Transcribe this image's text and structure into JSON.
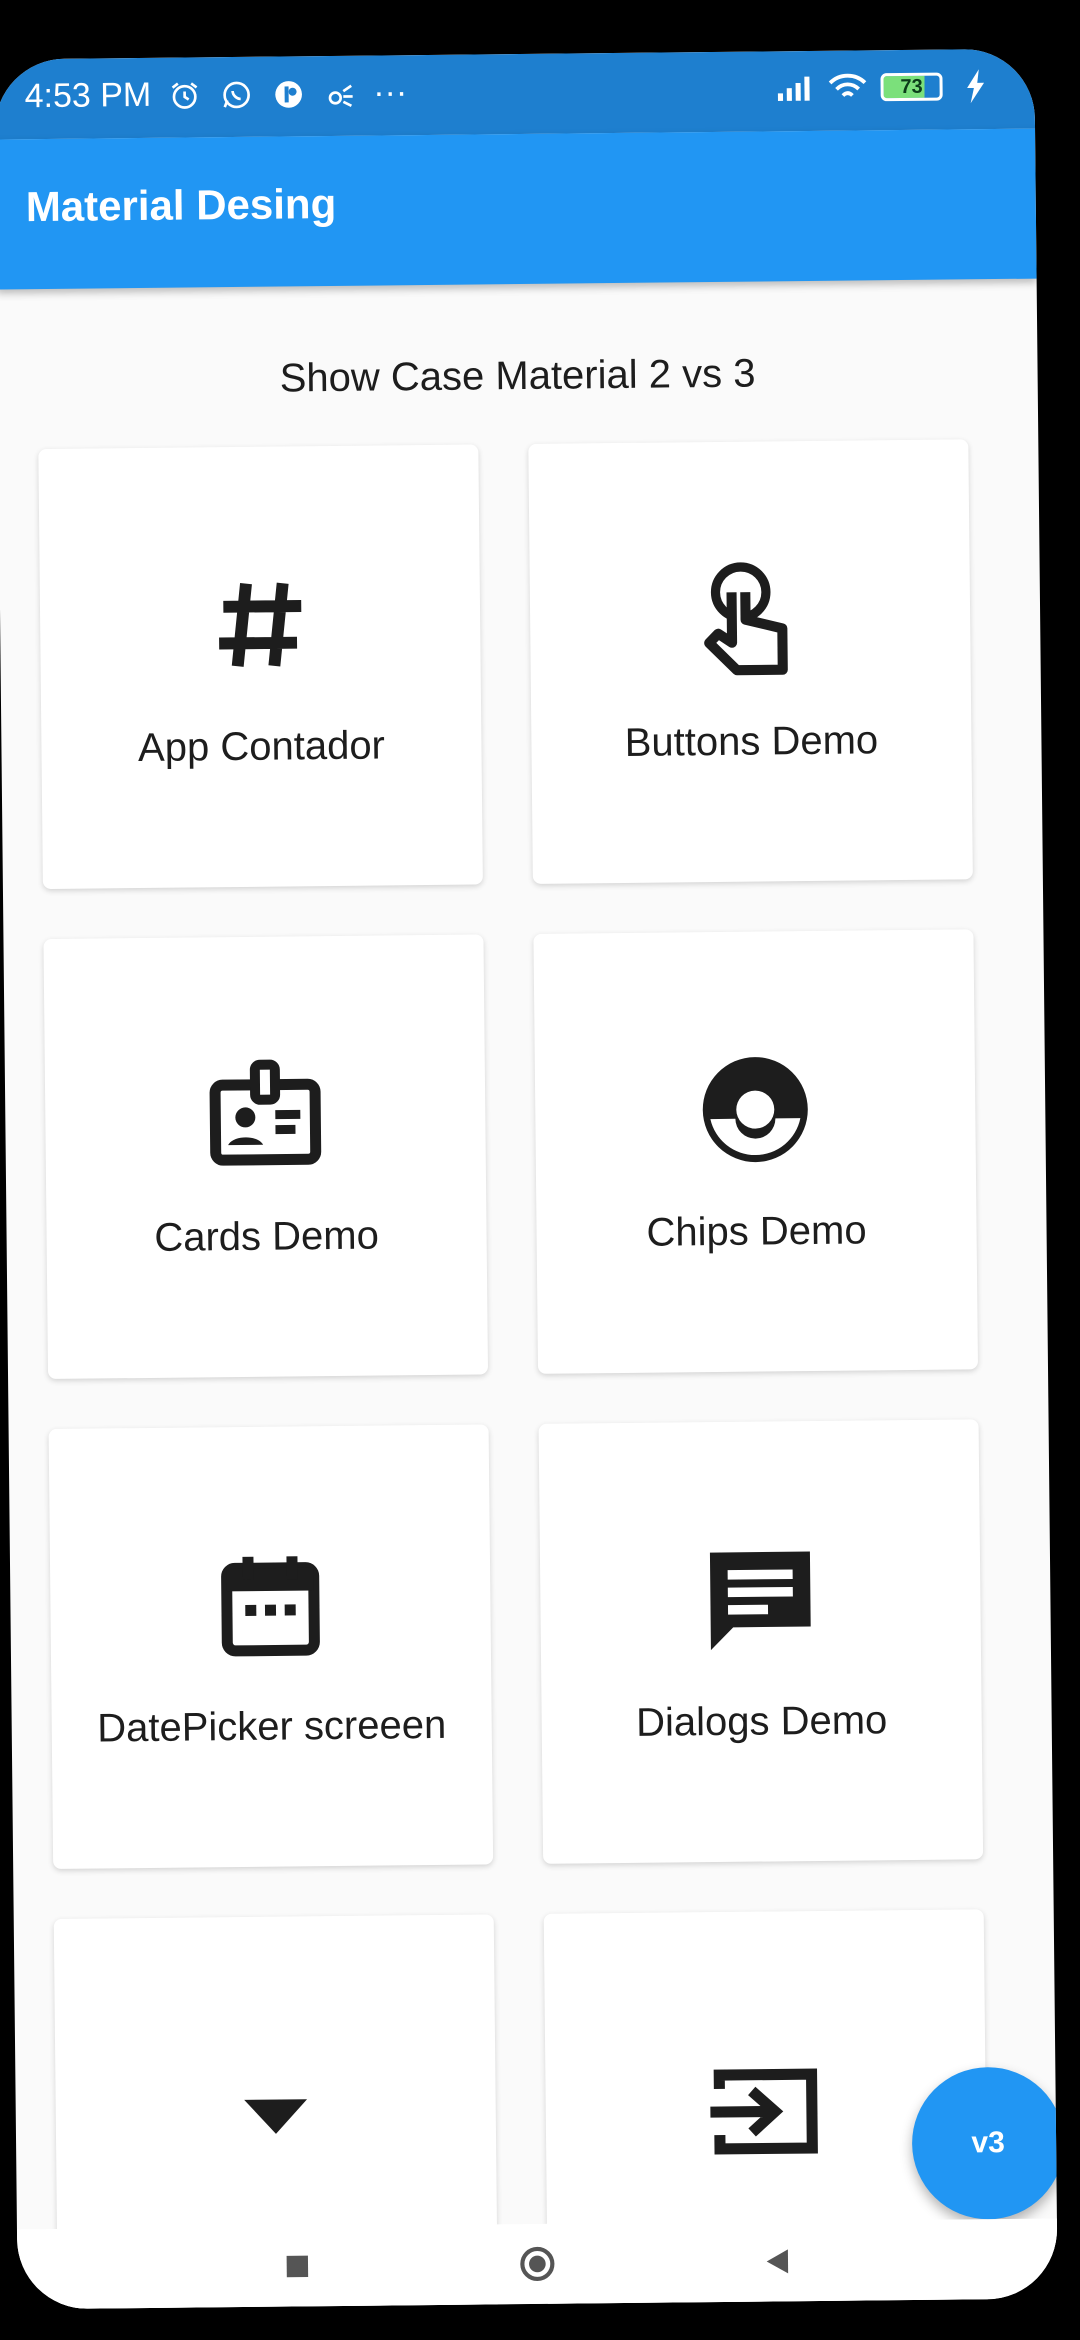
{
  "status_bar": {
    "time": "4:53 PM",
    "more": "···",
    "battery_level": "73"
  },
  "app_bar": {
    "title": "Material Desing"
  },
  "main": {
    "subtitle": "Show Case Material 2 vs 3",
    "cards": [
      {
        "label": "App Contador",
        "icon": "hash-icon"
      },
      {
        "label": "Buttons Demo",
        "icon": "touch-icon"
      },
      {
        "label": "Cards Demo",
        "icon": "badge-icon"
      },
      {
        "label": "Chips Demo",
        "icon": "pokeball-icon"
      },
      {
        "label": "DatePicker screeen",
        "icon": "calendar-icon"
      },
      {
        "label": "Dialogs Demo",
        "icon": "message-icon"
      },
      {
        "label": "",
        "icon": "dropdown-arrow-icon"
      },
      {
        "label": "",
        "icon": "input-icon"
      }
    ]
  },
  "fab": {
    "label": "v3"
  },
  "colors": {
    "primary": "#2196f3",
    "status_bar": "#1e7fcf",
    "background": "#fafafa",
    "card": "#ffffff",
    "text": "#1d1d1d"
  }
}
